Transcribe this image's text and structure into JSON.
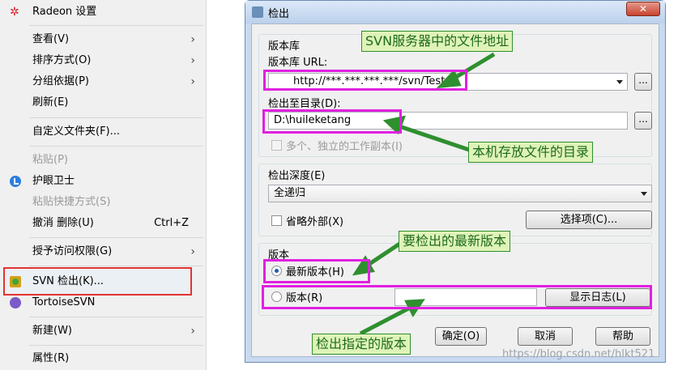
{
  "context_menu": {
    "items": [
      {
        "label": "Radeon 设置"
      },
      {
        "label": "查看(V)"
      },
      {
        "label": "排序方式(O)"
      },
      {
        "label": "分组依据(P)"
      },
      {
        "label": "刷新(E)"
      },
      {
        "label": "自定义文件夹(F)..."
      },
      {
        "label": "粘贴(P)"
      },
      {
        "label": "护眼卫士"
      },
      {
        "label": "粘贴快捷方式(S)"
      },
      {
        "label": "撤消 删除(U)",
        "shortcut": "Ctrl+Z"
      },
      {
        "label": "授予访问权限(G)"
      },
      {
        "label": "SVN 检出(K)..."
      },
      {
        "label": "TortoiseSVN"
      },
      {
        "label": "新建(W)"
      },
      {
        "label": "属性(R)"
      }
    ],
    "submenu_arrow": "›"
  },
  "dialog": {
    "title": "检出",
    "close_label": "✕",
    "repo_group_label": "版本库",
    "repo_url_label": "版本库 URL:",
    "repo_url_value": "http://***.***.***.***/svn/Test",
    "checkout_dir_label": "检出至目录(D):",
    "checkout_dir_value": "D:\\huileketang",
    "browse_label": "...",
    "multi_label": "多个、独立的工作副本(I)",
    "depth_label": "检出深度(E)",
    "depth_value": "全递归",
    "omit_externals_label": "省略外部(X)",
    "options_button": "选择项(C)...",
    "version_group_label": "版本",
    "head_revision_label": "最新版本(H)",
    "revision_label": "版本(R)",
    "revision_value": "",
    "show_log_button": "显示日志(L)",
    "ok_button": "确定(O)",
    "cancel_button": "取消",
    "help_button": "帮助"
  },
  "annotations": {
    "svn_url": "SVN服务器中的文件地址",
    "local_dir": "本机存放文件的目录",
    "latest": "要检出的最新版本",
    "specific": "检出指定的版本"
  },
  "watermark": "https://blog.csdn.net/hlkt521"
}
